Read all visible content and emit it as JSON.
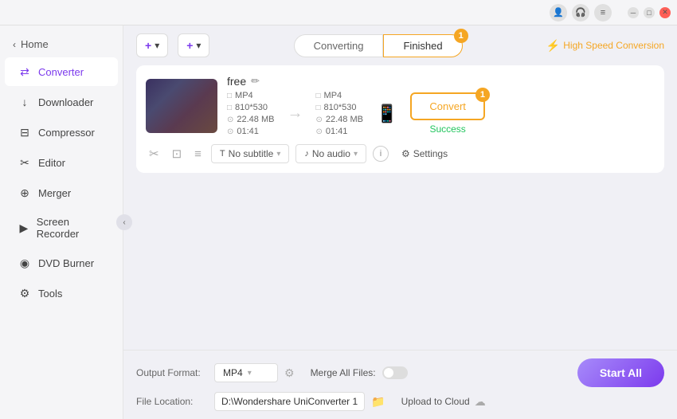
{
  "titlebar": {
    "icons": [
      "user-icon",
      "headphone-icon",
      "menu-icon"
    ],
    "window_controls": [
      "minimize",
      "maximize",
      "close"
    ]
  },
  "sidebar": {
    "home_label": "Home",
    "items": [
      {
        "id": "converter",
        "label": "Converter",
        "icon": "⇄",
        "active": true
      },
      {
        "id": "downloader",
        "label": "Downloader",
        "icon": "↓",
        "active": false
      },
      {
        "id": "compressor",
        "label": "Compressor",
        "icon": "⊟",
        "active": false
      },
      {
        "id": "editor",
        "label": "Editor",
        "icon": "✂",
        "active": false
      },
      {
        "id": "merger",
        "label": "Merger",
        "icon": "⊕",
        "active": false
      },
      {
        "id": "screen-recorder",
        "label": "Screen Recorder",
        "icon": "▶",
        "active": false
      },
      {
        "id": "dvd-burner",
        "label": "DVD Burner",
        "icon": "◉",
        "active": false
      },
      {
        "id": "tools",
        "label": "Tools",
        "icon": "⚙",
        "active": false
      }
    ]
  },
  "toolbar": {
    "add_file_label": "Add Files",
    "add_btn_label": "",
    "converting_tab": "Converting",
    "finished_tab": "Finished",
    "finished_badge": "1",
    "high_speed_label": "High Speed Conversion"
  },
  "file_card": {
    "file_name": "free",
    "src_format": "MP4",
    "src_resolution": "810*530",
    "src_size": "22.48 MB",
    "src_duration": "01:41",
    "dst_format": "MP4",
    "dst_resolution": "810*530",
    "dst_size": "22.48 MB",
    "dst_duration": "01:41",
    "subtitle_label": "No subtitle",
    "audio_label": "No audio",
    "settings_label": "Settings",
    "convert_btn_label": "Convert",
    "convert_badge": "1",
    "success_label": "Success"
  },
  "bottom": {
    "output_format_label": "Output Format:",
    "output_format_value": "MP4",
    "file_location_label": "File Location:",
    "file_location_value": "D:\\Wondershare UniConverter 1",
    "merge_label": "Merge All Files:",
    "upload_label": "Upload to Cloud",
    "start_all_label": "Start All",
    "gear_tooltip": "Settings"
  }
}
